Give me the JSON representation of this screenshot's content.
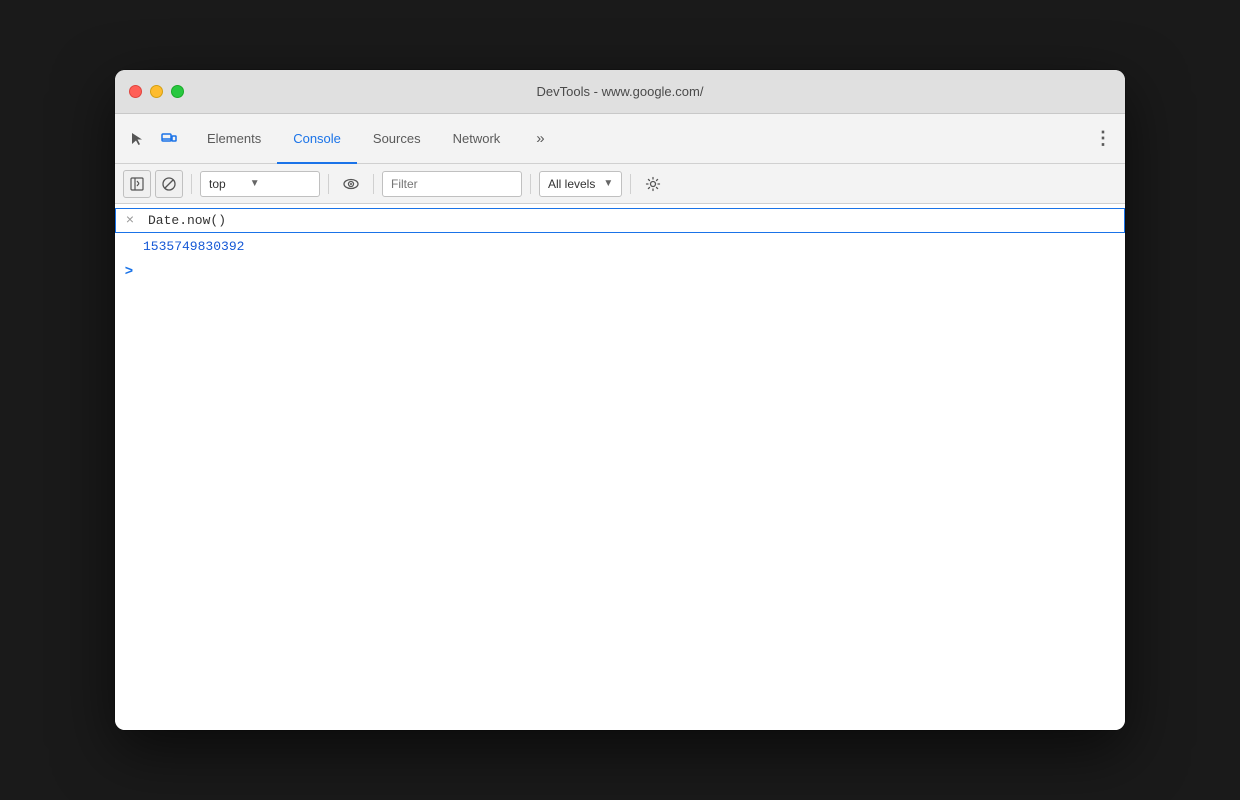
{
  "window": {
    "title": "DevTools - www.google.com/"
  },
  "tabs": {
    "items": [
      {
        "id": "elements",
        "label": "Elements",
        "active": false
      },
      {
        "id": "console",
        "label": "Console",
        "active": true
      },
      {
        "id": "sources",
        "label": "Sources",
        "active": false
      },
      {
        "id": "network",
        "label": "Network",
        "active": false
      }
    ],
    "more_label": "»",
    "menu_label": "⋮"
  },
  "toolbar": {
    "context": "top",
    "filter_placeholder": "Filter",
    "levels": "All levels",
    "context_arrow": "▼",
    "levels_arrow": "▼"
  },
  "console": {
    "input_value": "Date.now()",
    "result_value": "1535749830392",
    "close_label": "×",
    "chevron_label": ">"
  },
  "colors": {
    "accent_blue": "#1a73e8",
    "result_blue": "#1558d6"
  }
}
